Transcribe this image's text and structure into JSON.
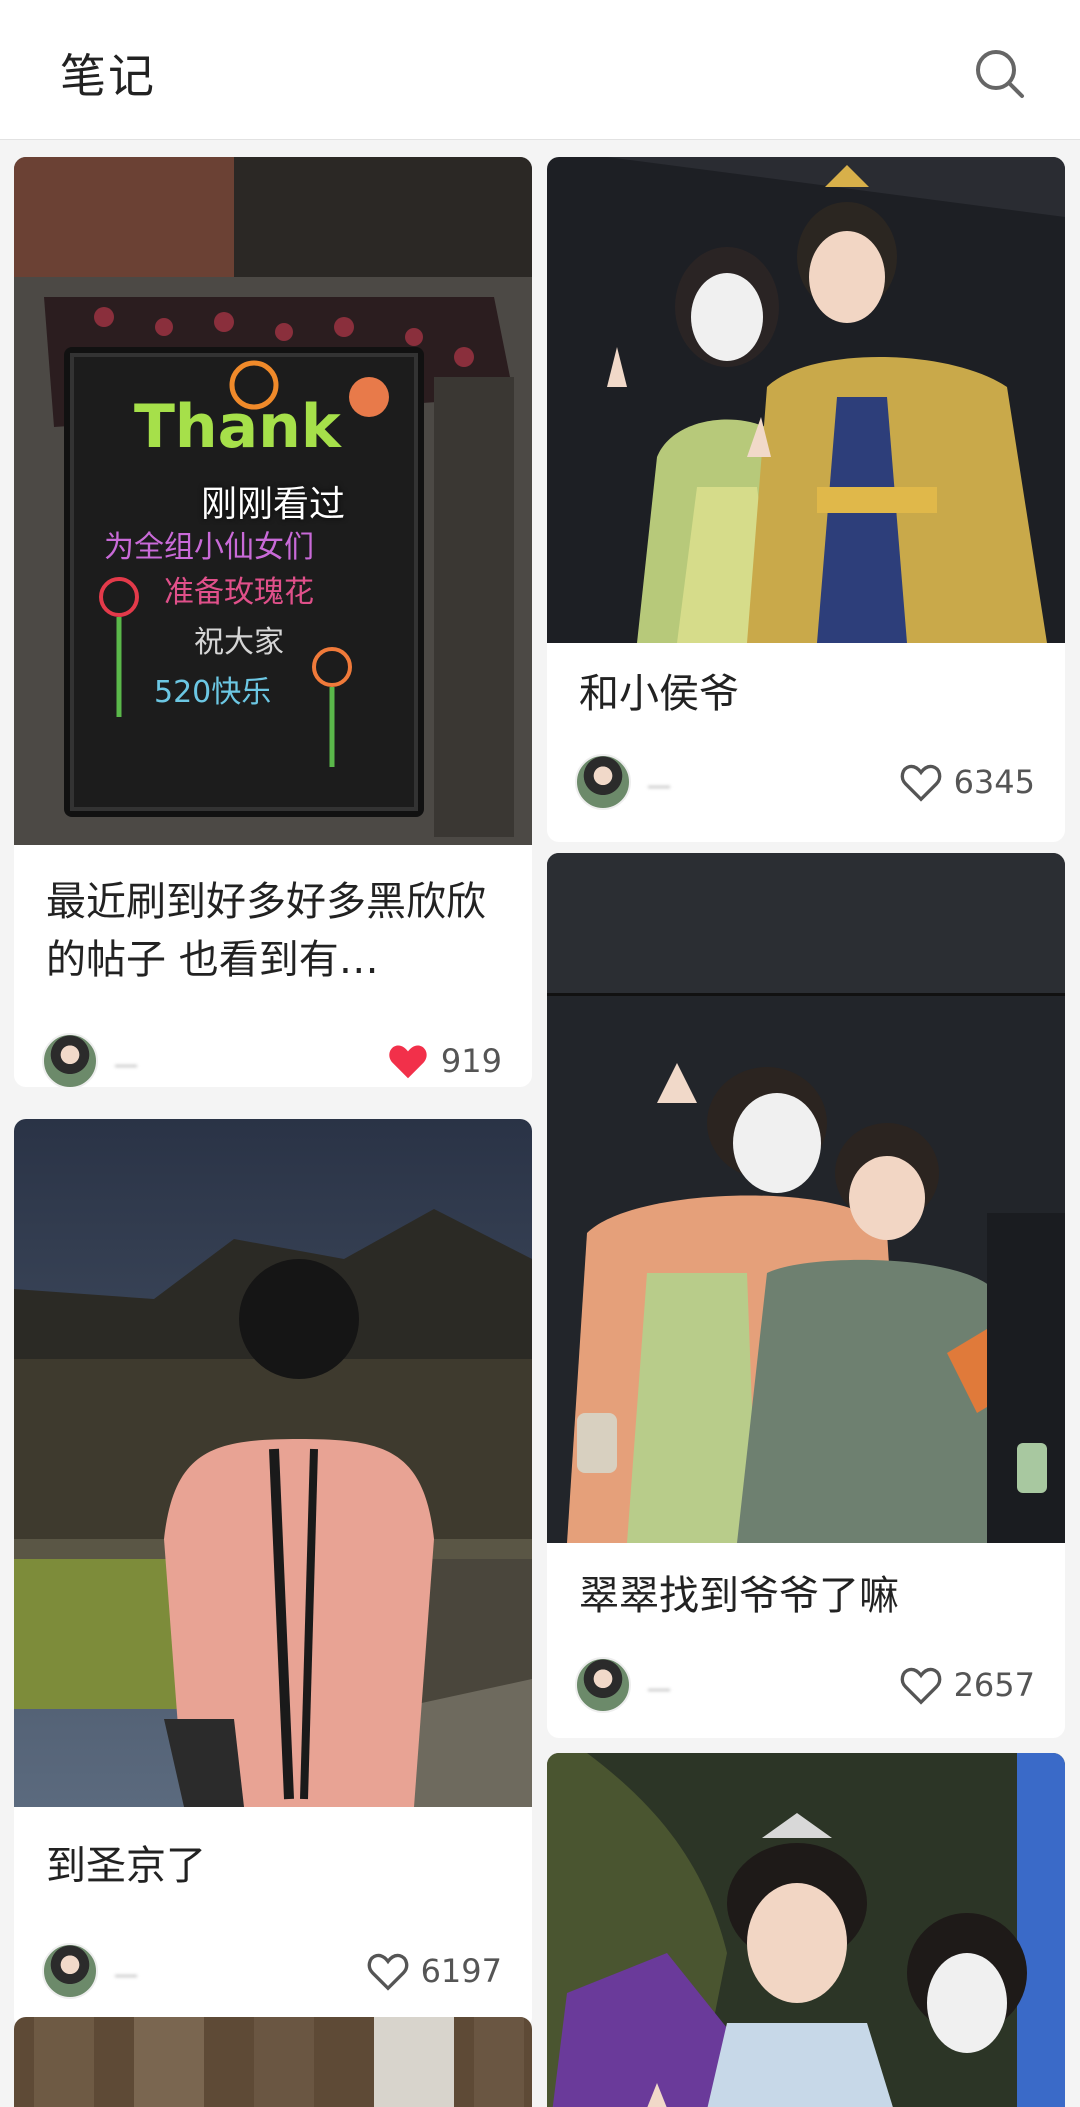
{
  "header": {
    "title": "笔记",
    "search_icon": "search-icon"
  },
  "cards": [
    {
      "title": "最近刷到好多好多黑欣欣的帖子 也看到有…",
      "viewed_label": "刚刚看过",
      "author": "一",
      "likes": "919",
      "liked": true,
      "image_description_icon": "chalkboard-photo"
    },
    {
      "title": "和小侯爷",
      "author": "一",
      "likes": "6345",
      "liked": false
    },
    {
      "title": "到圣京了",
      "author": "一",
      "likes": "6197",
      "liked": false
    },
    {
      "title": "翠翠找到爷爷了嘛",
      "author": "一",
      "likes": "2657",
      "liked": false
    }
  ],
  "colors": {
    "accent_like": "#f2304a",
    "header_bg": "#ffffff",
    "feed_bg": "#f4f4f4"
  }
}
